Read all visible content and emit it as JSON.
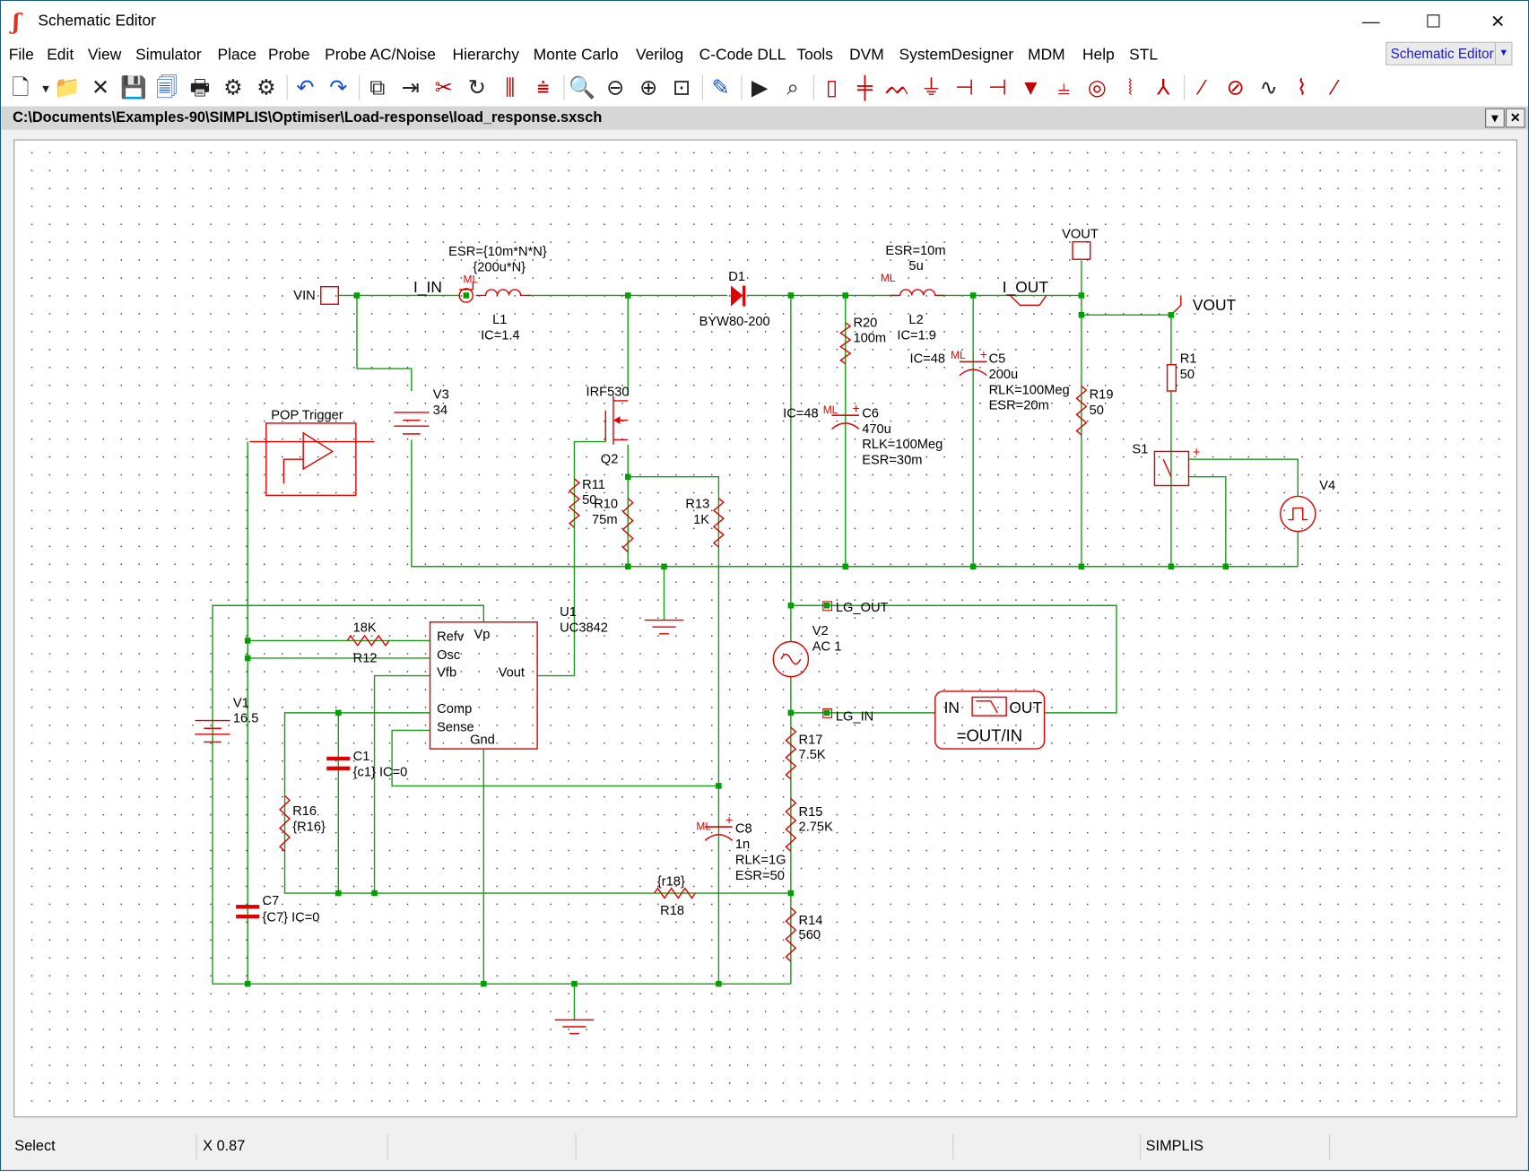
{
  "window": {
    "title": "Schematic Editor",
    "minimize": "—",
    "maximize": "☐",
    "close": "✕"
  },
  "menu": [
    "File",
    "Edit",
    "View",
    "Simulator",
    "Place",
    "Probe",
    "Probe AC/Noise",
    "Hierarchy",
    "Monte Carlo",
    "Verilog",
    "C-Code DLL",
    "Tools",
    "DVM",
    "SystemDesigner",
    "MDM",
    "Help",
    "STL"
  ],
  "mode_selector": {
    "value": "Schematic Editor"
  },
  "toolbar": [
    {
      "icon": "new-file-icon",
      "glyph": "🗋"
    },
    {
      "icon": "dropdown-arrow-icon",
      "glyph": "▾"
    },
    {
      "icon": "open-folder-icon",
      "glyph": "📁"
    },
    {
      "icon": "close-x-icon",
      "glyph": "✕"
    },
    {
      "icon": "save-icon",
      "glyph": "💾"
    },
    {
      "icon": "save-all-icon",
      "glyph": "🗐"
    },
    {
      "icon": "print-icon",
      "glyph": "🖶"
    },
    {
      "icon": "gear-icon",
      "glyph": "⚙"
    },
    {
      "icon": "gear-refresh-icon",
      "glyph": "⚙"
    },
    {
      "icon": "undo-icon",
      "glyph": "↶"
    },
    {
      "icon": "redo-icon",
      "glyph": "↷"
    },
    {
      "icon": "copy-icon",
      "glyph": "⧉"
    },
    {
      "icon": "paste-icon",
      "glyph": "⇥"
    },
    {
      "icon": "cut-icon",
      "glyph": "✂"
    },
    {
      "icon": "rotate-icon",
      "glyph": "↻"
    },
    {
      "icon": "mirror-lr-icon",
      "glyph": "⫼"
    },
    {
      "icon": "mirror-ud-icon",
      "glyph": "⩧"
    },
    {
      "icon": "zoom-fit-icon",
      "glyph": "🔍"
    },
    {
      "icon": "zoom-out-icon",
      "glyph": "⊖"
    },
    {
      "icon": "zoom-in-icon",
      "glyph": "⊕"
    },
    {
      "icon": "zoom-box-icon",
      "glyph": "⊡"
    },
    {
      "icon": "pencil-wire-icon",
      "glyph": "✎"
    },
    {
      "icon": "run-icon",
      "glyph": "▶"
    },
    {
      "icon": "binoculars-find-icon",
      "glyph": "⌕"
    },
    {
      "icon": "resistor-icon",
      "glyph": "▯"
    },
    {
      "icon": "capacitor-icon",
      "glyph": "╪"
    },
    {
      "icon": "inductor-icon",
      "glyph": "ᨓ"
    },
    {
      "icon": "ground-icon",
      "glyph": "⏚"
    },
    {
      "icon": "nmos-icon",
      "glyph": "⊣"
    },
    {
      "icon": "pmos-icon",
      "glyph": "⊣"
    },
    {
      "icon": "diode-icon",
      "glyph": "▼"
    },
    {
      "icon": "battery-icon",
      "glyph": "⫨"
    },
    {
      "icon": "ac-source-icon",
      "glyph": "◎"
    },
    {
      "icon": "transformer-icon",
      "glyph": "⦚"
    },
    {
      "icon": "terminal-icon",
      "glyph": "⅄"
    },
    {
      "icon": "voltage-probe-icon",
      "glyph": "⁄"
    },
    {
      "icon": "current-probe-icon",
      "glyph": "⊘"
    },
    {
      "icon": "waveform-icon",
      "glyph": "∿"
    },
    {
      "icon": "noise-waveform-icon",
      "glyph": "⌇"
    },
    {
      "icon": "diff-probe-icon",
      "glyph": "⁄"
    }
  ],
  "document": {
    "path": "C:\\Documents\\Examples-90\\SIMPLIS\\Optimiser\\Load-response\\load_response.sxsch",
    "menu_btn": "▾",
    "close_btn": "✕"
  },
  "schematic": {
    "vin": "VIN",
    "i_in": "I_IN",
    "ml": "ML",
    "l1_esr": "ESR={10m*N*N}",
    "l1_val": "{200u*N}",
    "l1_ref": "L1",
    "l1_ic": "IC=1.4",
    "d1_ref": "D1",
    "d1_val": "BYW80-200",
    "l2_esr": "ESR=10m",
    "l2_val": "5u",
    "l2_ref": "L2",
    "l2_ic": "IC=1.9",
    "i_out": "I_OUT",
    "vout_port": "VOUT",
    "vout_probe": "VOUT",
    "r20_ref": "R20",
    "r20_val": "100m",
    "c5_ic": "IC=48",
    "c5_ref": "C5",
    "c5_val": "200u",
    "c5_rlk": "RLK=100Meg",
    "c5_esr": "ESR=20m",
    "c6_ic": "IC=48",
    "c6_ref": "C6",
    "c6_val": "470u",
    "c6_rlk": "RLK=100Meg",
    "c6_esr": "ESR=30m",
    "r19_ref": "R19",
    "r19_val": "50",
    "r1_ref": "R1",
    "r1_val": "50",
    "s1_ref": "S1",
    "v4_ref": "V4",
    "v3_ref": "V3",
    "v3_val": "34",
    "pop": "POP Trigger",
    "q2_val": "IRF530",
    "q2_ref": "Q2",
    "r11_ref": "R11",
    "r11_val": "50",
    "r10_ref": "R10",
    "r10_val": "75m",
    "r13_ref": "R13",
    "r13_val": "1K",
    "u1_ref": "U1",
    "u1_val": "UC3842",
    "pin_refv": "Refv",
    "pin_vp": "Vp",
    "pin_osc": "Osc",
    "pin_vfb": "Vfb",
    "pin_vout": "Vout",
    "pin_comp": "Comp",
    "pin_sense": "Sense",
    "pin_gnd": "Gnd",
    "r12_val": "18K",
    "r12_ref": "R12",
    "v1_ref": "V1",
    "v1_val": "16.5",
    "c1_ref": "C1",
    "c1_val": "{c1} IC=0",
    "r16_ref": "R16",
    "r16_val": "{R16}",
    "c7_ref": "C7",
    "c7_val": "{C7} IC=0",
    "r18_val": "{r18}",
    "r18_ref": "R18",
    "c8_ref": "C8",
    "c8_val": "1n",
    "c8_rlk": "RLK=1G",
    "c8_esr": "ESR=50",
    "lg_out": "LG_OUT",
    "lg_in": "LG_IN",
    "v2_ref": "V2",
    "v2_val": "AC 1",
    "r17_ref": "R17",
    "r17_val": "7.5K",
    "r15_ref": "R15",
    "r15_val": "2.75K",
    "r14_ref": "R14",
    "r14_val": "560",
    "bode_in": "IN",
    "bode_out": "OUT",
    "bode_expr": "=OUT/IN",
    "plus": "+"
  },
  "status": {
    "mode": "Select",
    "coord": "X 0.87",
    "simulator": "SIMPLIS"
  },
  "colors": {
    "wire": "#1a9a1a",
    "component": "#e00000",
    "junction": "#00a000",
    "accent": "#1a1ad0"
  }
}
